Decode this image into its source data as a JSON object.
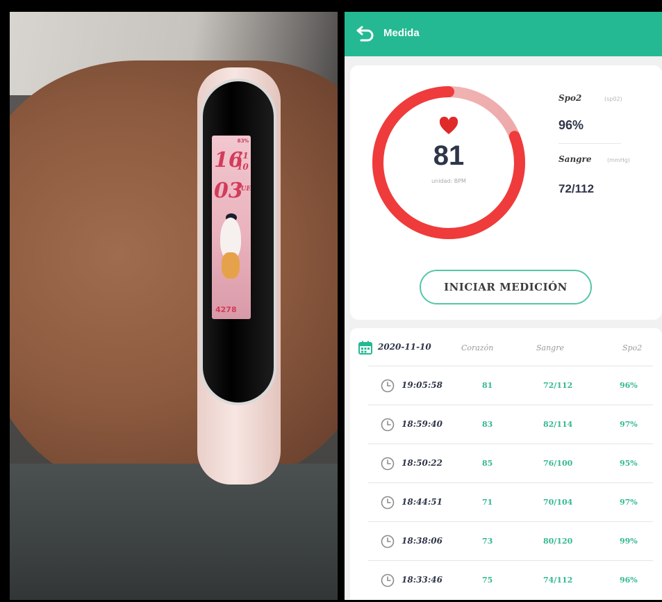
{
  "photo": {
    "watch": {
      "battery": "83%",
      "hour": "16",
      "minute": "03",
      "date_top": "11",
      "date_bottom": "10",
      "weekday": "TUE",
      "steps": "4278"
    }
  },
  "appbar": {
    "title": "Medida",
    "back_icon": "back-arrow-icon",
    "color": "#25b993"
  },
  "measurement": {
    "bpm": "81",
    "bpm_unit": "unidad: BPM",
    "gauge_fraction": 0.81,
    "gauge_color": "#ef3b3b",
    "spo2_label": "Spo2",
    "spo2_unit": "(sp02)",
    "spo2_value": "96%",
    "blood_label": "Sangre",
    "blood_unit": "(mmHg)",
    "blood_value": "72/112",
    "start_button": "INICIAR MEDICIÓN"
  },
  "history": {
    "date": "2020-11-10",
    "columns": {
      "heart": "Corazón",
      "blood": "Sangre",
      "spo2": "Spo2"
    },
    "rows": [
      {
        "time": "19:05:58",
        "heart": "81",
        "blood": "72/112",
        "spo2": "96%"
      },
      {
        "time": "18:59:40",
        "heart": "83",
        "blood": "82/114",
        "spo2": "97%"
      },
      {
        "time": "18:50:22",
        "heart": "85",
        "blood": "76/100",
        "spo2": "95%"
      },
      {
        "time": "18:44:51",
        "heart": "71",
        "blood": "70/104",
        "spo2": "97%"
      },
      {
        "time": "18:38:06",
        "heart": "73",
        "blood": "80/120",
        "spo2": "99%"
      },
      {
        "time": "18:33:46",
        "heart": "75",
        "blood": "74/112",
        "spo2": "96%"
      }
    ]
  }
}
